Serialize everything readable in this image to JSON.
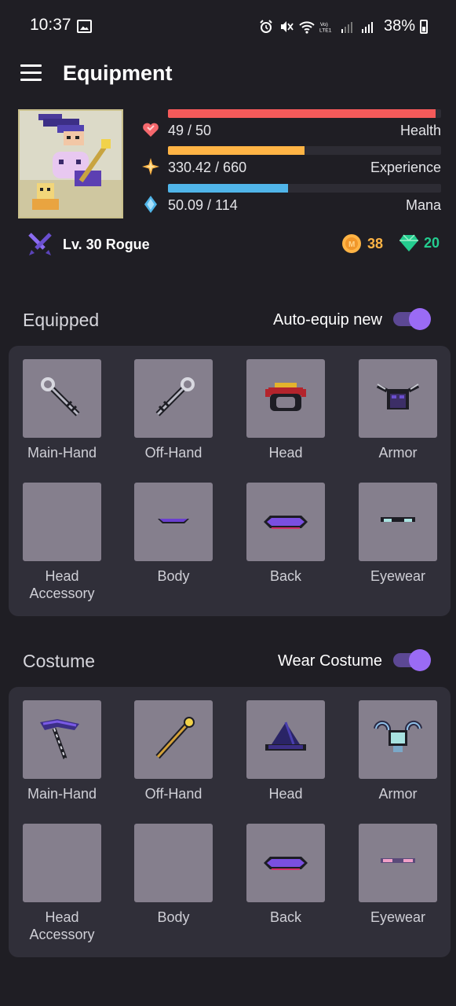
{
  "status_bar": {
    "time": "10:37",
    "battery": "38%"
  },
  "app_bar": {
    "title": "Equipment"
  },
  "stats": {
    "health": {
      "value": "49 / 50",
      "label": "Health",
      "fraction": 0.98,
      "color": "#f55a5a"
    },
    "experience": {
      "value": "330.42 / 660",
      "label": "Experience",
      "fraction": 0.5,
      "color": "#ffb445"
    },
    "mana": {
      "value": "50.09 / 114",
      "label": "Mana",
      "fraction": 0.44,
      "color": "#50b5e9"
    }
  },
  "profile": {
    "level_class": "Lv. 30 Rogue",
    "gold": "38",
    "gems": "20",
    "colors": {
      "gold": "#ffb445",
      "gems": "#24cc8f"
    }
  },
  "equipped": {
    "title": "Equipped",
    "toggle_label": "Auto-equip new",
    "toggle_on": true,
    "slots": [
      {
        "label": "Main-Hand",
        "icon": "key-weapon-icon"
      },
      {
        "label": "Off-Hand",
        "icon": "key-weapon-icon"
      },
      {
        "label": "Head",
        "icon": "helmet-icon"
      },
      {
        "label": "Armor",
        "icon": "rogue-armor-icon"
      },
      {
        "label": "Head\nAccessory",
        "icon": ""
      },
      {
        "label": "Body",
        "icon": "purple-sash-icon"
      },
      {
        "label": "Back",
        "icon": "purple-cape-icon"
      },
      {
        "label": "Eyewear",
        "icon": "eye-mask-icon"
      }
    ]
  },
  "costume": {
    "title": "Costume",
    "toggle_label": "Wear Costume",
    "toggle_on": true,
    "slots": [
      {
        "label": "Main-Hand",
        "icon": "purple-scythe-icon"
      },
      {
        "label": "Off-Hand",
        "icon": "golden-staff-icon"
      },
      {
        "label": "Head",
        "icon": "wizard-hat-icon"
      },
      {
        "label": "Armor",
        "icon": "ice-armor-icon"
      },
      {
        "label": "Head\nAccessory",
        "icon": ""
      },
      {
        "label": "Body",
        "icon": ""
      },
      {
        "label": "Back",
        "icon": "purple-cape-icon"
      },
      {
        "label": "Eyewear",
        "icon": "pink-mask-icon"
      }
    ]
  },
  "accent_color": "#9a6bf5"
}
